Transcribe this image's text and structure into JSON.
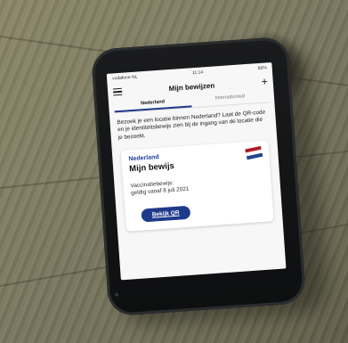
{
  "status_bar": {
    "carrier": "vodafone NL",
    "time": "11:14",
    "battery": "66%"
  },
  "header": {
    "title": "Mijn bewijzen"
  },
  "tabs": [
    {
      "label": "Nederland",
      "active": true
    },
    {
      "label": "Internationaal",
      "active": false
    }
  ],
  "intro_text": "Bezoek je een locatie binnen Nederland? Laat de QR-code en je identiteitsbewijs zien bij de ingang van de locatie die je bezoekt.",
  "card": {
    "country": "Nederland",
    "title": "Mijn bewijs",
    "detail_line1": "Vaccinatiebewijs:",
    "detail_line2": "geldig vanaf 8 juli 2021",
    "button_label": "Bekijk QR",
    "flag_colors": [
      "#ae1c28",
      "#ffffff",
      "#21468b"
    ]
  },
  "colors": {
    "accent": "#1f3a8a"
  }
}
